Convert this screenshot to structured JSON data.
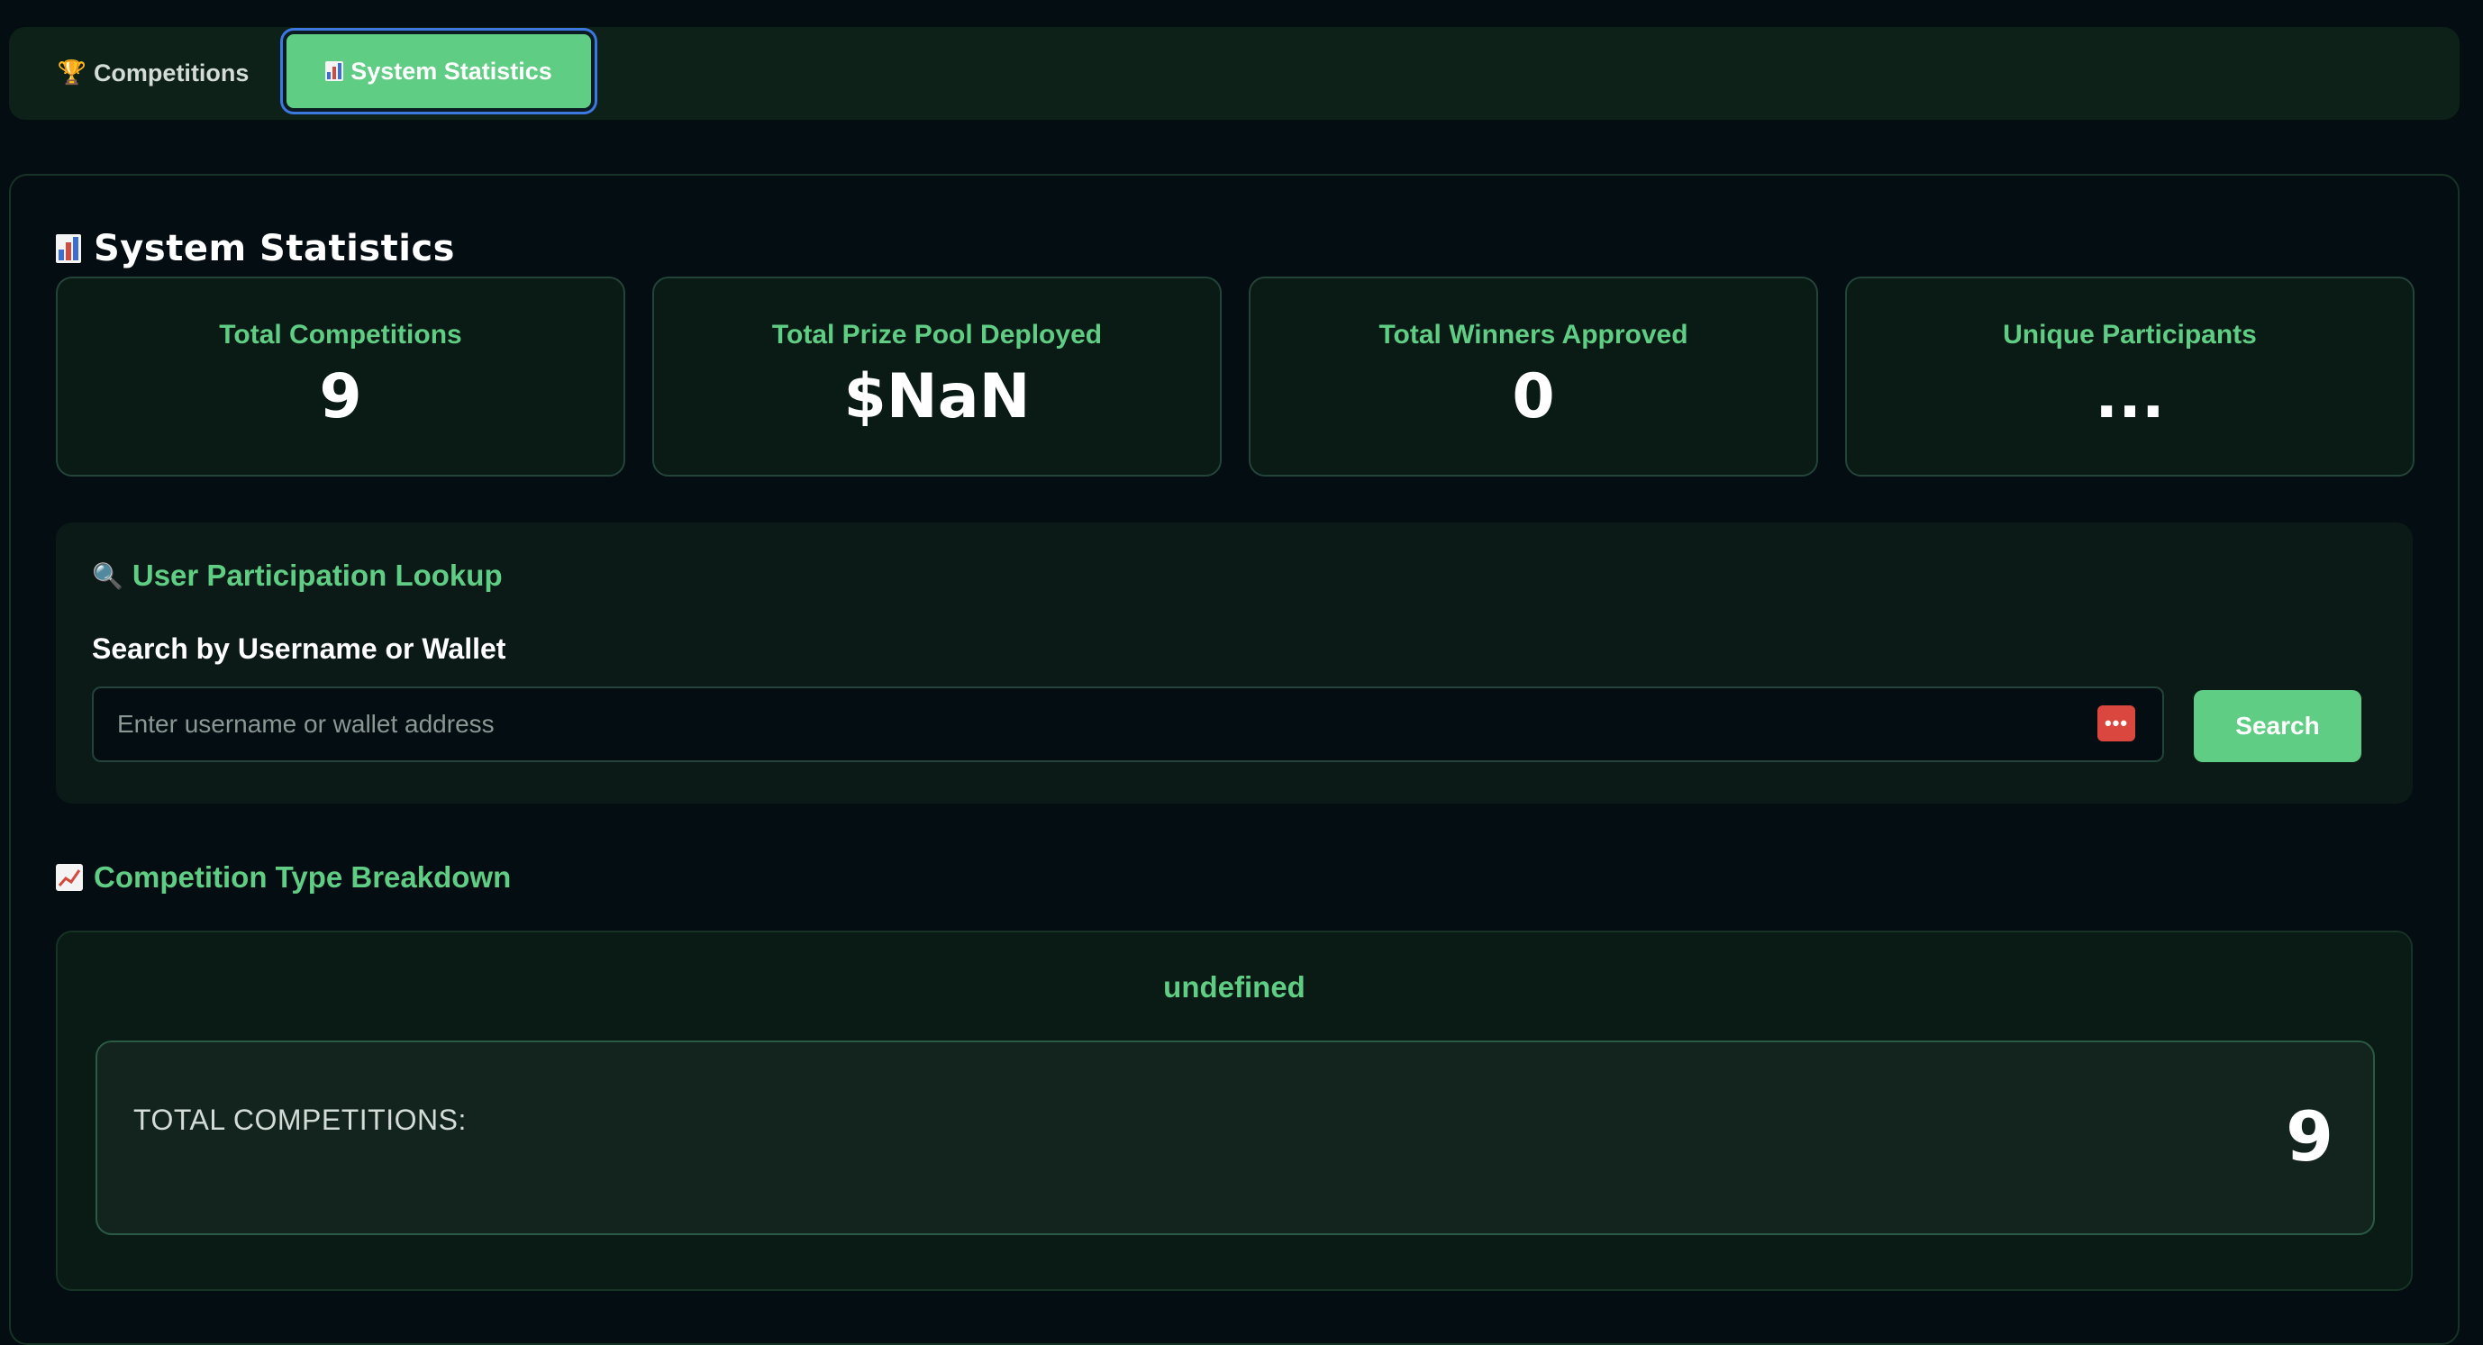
{
  "tabs": [
    {
      "label": "Competitions",
      "icon": "trophy-icon",
      "active": false
    },
    {
      "label": "System Statistics",
      "icon": "bar-chart-icon",
      "active": true
    }
  ],
  "section": {
    "title": "System Statistics",
    "icon": "bar-chart-icon"
  },
  "stats": [
    {
      "label": "Total Competitions",
      "value": "9"
    },
    {
      "label": "Total Prize Pool Deployed",
      "value": "$NaN"
    },
    {
      "label": "Total Winners Approved",
      "value": "0"
    },
    {
      "label": "Unique Participants",
      "value": "..."
    }
  ],
  "lookup": {
    "title": "User Participation Lookup",
    "icon": "magnifier-icon",
    "field_label": "Search by Username or Wallet",
    "placeholder": "Enter username or wallet address",
    "value": "",
    "button_label": "Search"
  },
  "breakdown": {
    "title": "Competition Type Breakdown",
    "icon": "trend-chart-icon",
    "heading": "undefined",
    "label": "TOTAL COMPETITIONS:",
    "value": "9"
  },
  "colors": {
    "accent": "#5fcd83",
    "background": "#040d12",
    "panel": "#0a1a15",
    "focus_ring": "#3c78e0",
    "password_manager": "#d9473f"
  }
}
